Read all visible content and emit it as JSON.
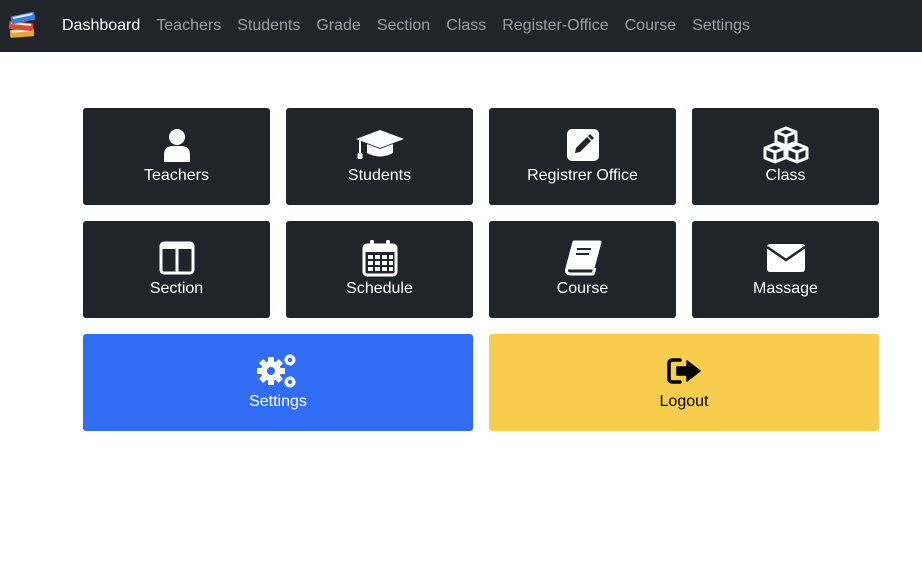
{
  "nav": {
    "brand_icon": "books-icon",
    "links": [
      {
        "label": "Dashboard",
        "active": true
      },
      {
        "label": "Teachers"
      },
      {
        "label": "Students"
      },
      {
        "label": "Grade"
      },
      {
        "label": "Section"
      },
      {
        "label": "Class"
      },
      {
        "label": "Register-Office"
      },
      {
        "label": "Course"
      },
      {
        "label": "Settings"
      }
    ]
  },
  "tiles": {
    "teachers": {
      "label": "Teachers",
      "icon": "user-icon"
    },
    "students": {
      "label": "Students",
      "icon": "graduation-cap-icon"
    },
    "registrar": {
      "label": "Registrer Office",
      "icon": "pencil-square-icon"
    },
    "class": {
      "label": "Class",
      "icon": "cubes-icon"
    },
    "section": {
      "label": "Section",
      "icon": "columns-icon"
    },
    "schedule": {
      "label": "Schedule",
      "icon": "calendar-icon"
    },
    "course": {
      "label": "Course",
      "icon": "book-icon"
    },
    "massage": {
      "label": "Massage",
      "icon": "envelope-icon"
    },
    "settings": {
      "label": "Settings",
      "icon": "gears-icon"
    },
    "logout": {
      "label": "Logout",
      "icon": "sign-out-icon"
    }
  },
  "colors": {
    "navbar": "#212529",
    "tile_dark": "#212529",
    "tile_blue": "#316cf4",
    "tile_yellow": "#f8cd4f"
  }
}
